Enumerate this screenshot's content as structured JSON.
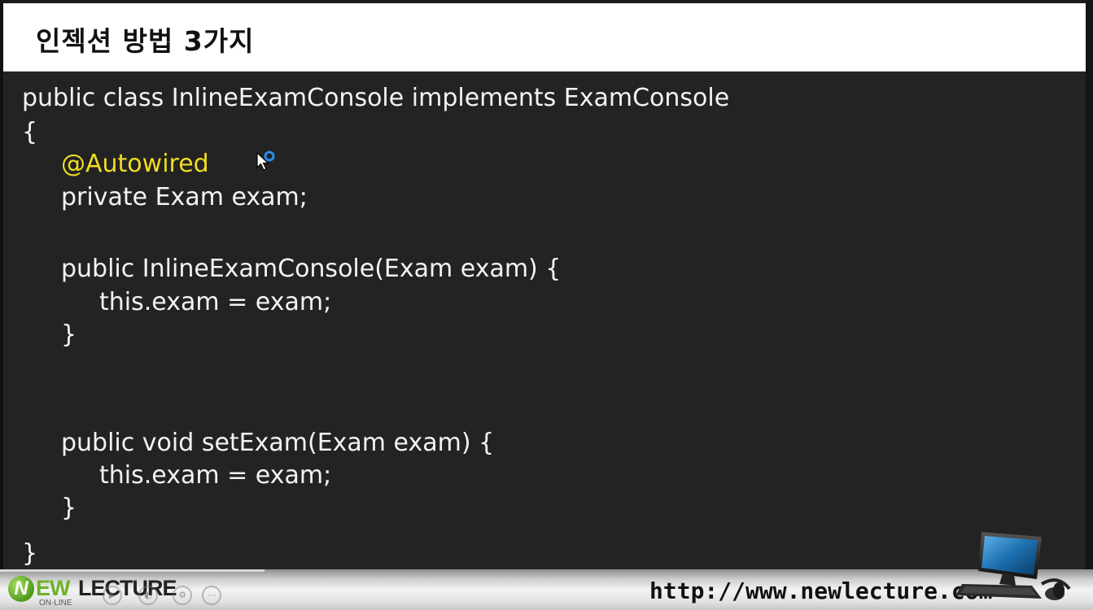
{
  "slide": {
    "title": "인젝션 방법 3가지"
  },
  "code": {
    "lines": [
      "public class InlineExamConsole implements ExamConsole",
      "{",
      "@Autowired",
      "private Exam exam;",
      "public InlineExamConsole(Exam exam) {",
      "this.exam = exam;",
      "}",
      "public void setExam(Exam exam) {",
      "this.exam = exam;",
      "}",
      "}"
    ]
  },
  "colors": {
    "code_background": "#232323",
    "code_text": "#f3f3f3",
    "annotation": "#f0dc20",
    "logo_green": "#6fb22b"
  },
  "footer": {
    "logo_mark": "N",
    "logo_ew": "EW",
    "logo_lecture": "LECTURE",
    "logo_online": "ON-LINE",
    "url": "http://www.newlecture.com",
    "controls": [
      "play-icon",
      "volume-icon",
      "settings-icon",
      "fullscreen-icon",
      "more-icon"
    ]
  }
}
